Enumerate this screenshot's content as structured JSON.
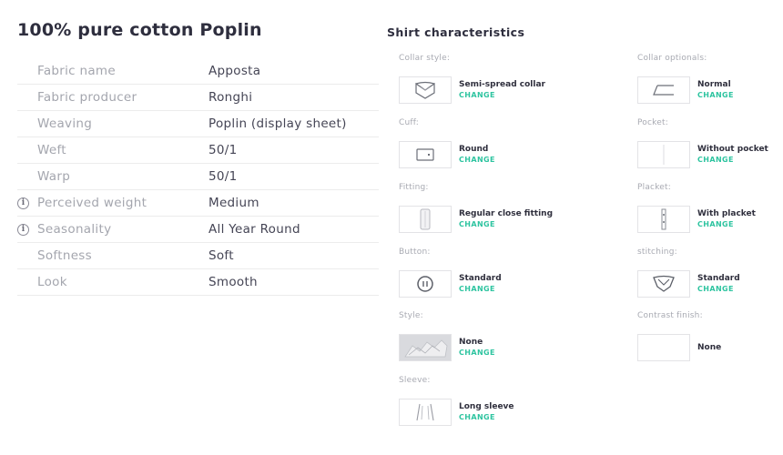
{
  "fabric": {
    "title": "100% pure cotton Poplin",
    "rows": [
      {
        "label": "Fabric name",
        "value": "Apposta",
        "info": false
      },
      {
        "label": "Fabric producer",
        "value": "Ronghi",
        "info": false
      },
      {
        "label": "Weaving",
        "value": "Poplin (display sheet)",
        "info": false
      },
      {
        "label": "Weft",
        "value": "50/1",
        "info": false
      },
      {
        "label": "Warp",
        "value": "50/1",
        "info": false
      },
      {
        "label": "Perceived weight",
        "value": "Medium",
        "info": true
      },
      {
        "label": "Seasonality",
        "value": "All Year Round",
        "info": true
      },
      {
        "label": "Softness",
        "value": "Soft",
        "info": false
      },
      {
        "label": "Look",
        "value": "Smooth",
        "info": false
      }
    ],
    "info_glyph": "i"
  },
  "shirt": {
    "title": "Shirt characteristics",
    "change_label": "CHANGE",
    "items": {
      "collar_style": {
        "label": "Collar style:",
        "value": "Semi-spread collar",
        "icon": "collar-icon"
      },
      "collar_optionals": {
        "label": "Collar optionals:",
        "value": "Normal",
        "icon": "collar-optional-icon"
      },
      "cuff": {
        "label": "Cuff:",
        "value": "Round",
        "icon": "cuff-icon"
      },
      "pocket": {
        "label": "Pocket:",
        "value": "Without pocket",
        "icon": "pocket-icon"
      },
      "fitting": {
        "label": "Fitting:",
        "value": "Regular close fitting",
        "icon": "fitting-icon"
      },
      "placket": {
        "label": "Placket:",
        "value": "With placket",
        "icon": "placket-icon"
      },
      "button": {
        "label": "Button:",
        "value": "Standard",
        "icon": "button-icon"
      },
      "stitching": {
        "label": "stitching:",
        "value": "Standard",
        "icon": "stitching-icon"
      },
      "style": {
        "label": "Style:",
        "value": "None",
        "icon": "style-icon"
      },
      "contrast_finish": {
        "label": "Contrast finish:",
        "value": "None",
        "icon": "contrast-finish-icon"
      },
      "sleeve": {
        "label": "Sleeve:",
        "value": "Long sleeve",
        "icon": "sleeve-icon"
      }
    }
  },
  "colors": {
    "accent": "#2ec4a0",
    "label": "#a4a6ae",
    "text": "#454555"
  }
}
